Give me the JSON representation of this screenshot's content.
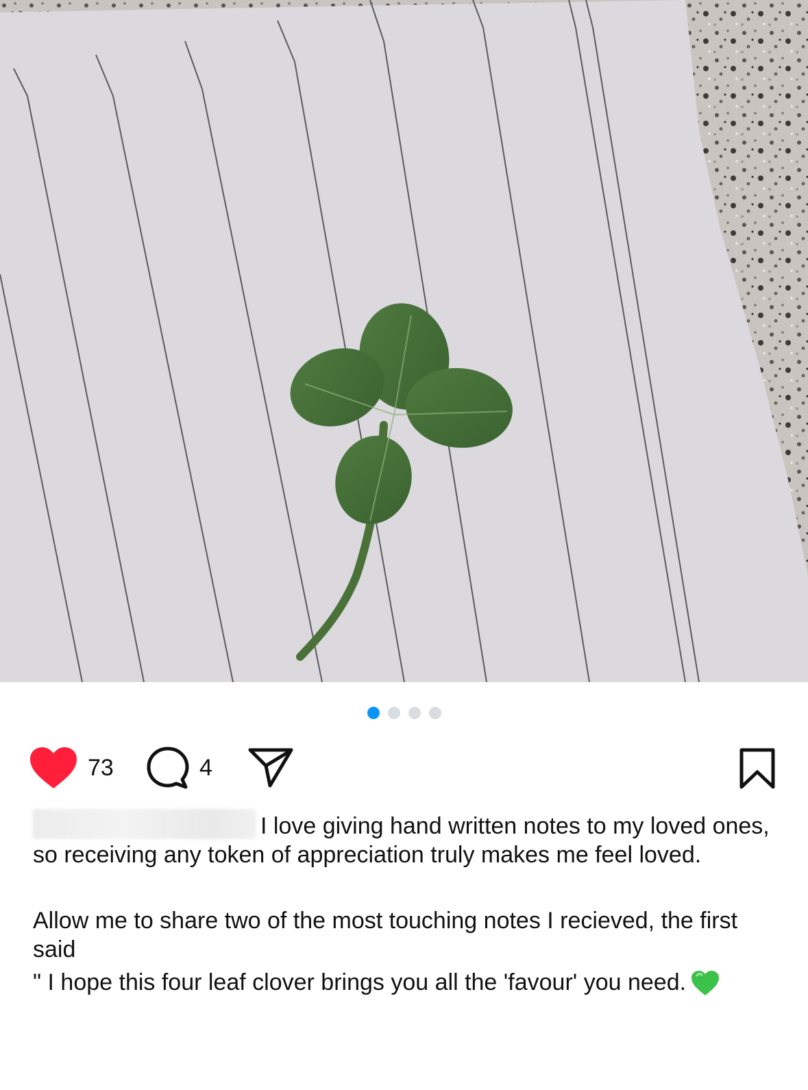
{
  "post": {
    "image_description_icon": "four-leaf-clover-photo",
    "carousel": {
      "total": 4,
      "active_index": 0
    },
    "likes_count": "73",
    "comments_count": "4",
    "caption": {
      "username": "",
      "paragraph1": "I love giving hand written notes to my loved ones, so receiving any token of appreciation truly makes me feel loved.",
      "paragraph2": "Allow me to share two of the most touching notes I recieved, the first said",
      "paragraph3": "\" I hope this four leaf clover brings you all the 'favour' you need.",
      "emoji": "green-heart-icon"
    }
  },
  "colors": {
    "like_red": "#ff1f3a",
    "dot_active": "#0a95f6",
    "dot_inactive": "#d9dde2",
    "emoji_green": "#3cc14a"
  }
}
